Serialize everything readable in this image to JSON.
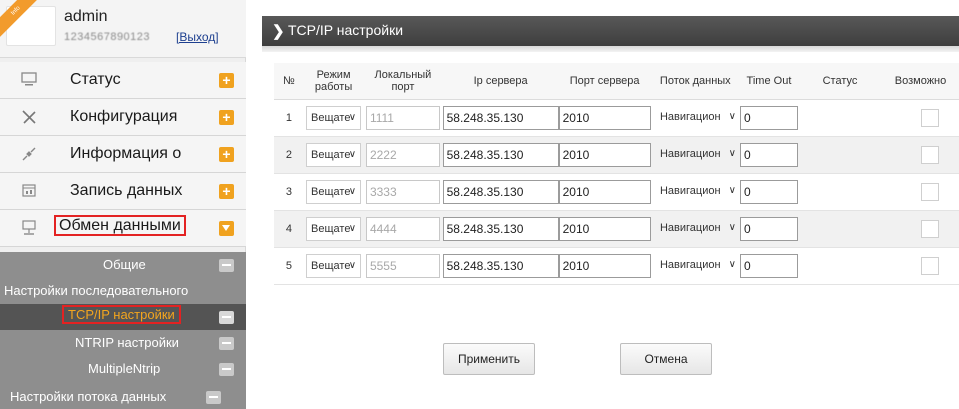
{
  "user": {
    "badge": "Info",
    "name": "admin",
    "serial": "1234567890123",
    "logout": "[Выход]"
  },
  "menu": [
    {
      "label": "Статус",
      "icon": "monitor-icon"
    },
    {
      "label": "Конфигурация",
      "icon": "tools-icon"
    },
    {
      "label": "Информация о",
      "icon": "satellite-icon"
    },
    {
      "label": "Запись данных",
      "icon": "calendar-icon"
    },
    {
      "label": "Обмен данными",
      "icon": "network-icon"
    }
  ],
  "submenu": [
    {
      "label": "Общие"
    },
    {
      "label": "Настройки последовательного"
    },
    {
      "label": "TCP/IP настройки"
    },
    {
      "label": "NTRIP настройки"
    },
    {
      "label": "MultipleNtrip"
    },
    {
      "label": "Настройки потока данных"
    }
  ],
  "page": {
    "title": "TCP/IP настройки"
  },
  "table": {
    "headers": {
      "no": "№",
      "mode": "Режим работы",
      "local_port": "Локальный порт",
      "server_ip": "Ip сервера",
      "server_port": "Порт сервера",
      "stream": "Поток данных",
      "timeout": "Time Out",
      "status": "Статус",
      "enable": "Возможно"
    },
    "rows": [
      {
        "no": "1",
        "mode": "Вещате",
        "local_port": "1111",
        "server_ip": "58.248.35.130",
        "server_port": "2010",
        "stream": "Навигацион",
        "timeout": "0",
        "status": ""
      },
      {
        "no": "2",
        "mode": "Вещате",
        "local_port": "2222",
        "server_ip": "58.248.35.130",
        "server_port": "2010",
        "stream": "Навигацион",
        "timeout": "0",
        "status": ""
      },
      {
        "no": "3",
        "mode": "Вещате",
        "local_port": "3333",
        "server_ip": "58.248.35.130",
        "server_port": "2010",
        "stream": "Навигацион",
        "timeout": "0",
        "status": ""
      },
      {
        "no": "4",
        "mode": "Вещате",
        "local_port": "4444",
        "server_ip": "58.248.35.130",
        "server_port": "2010",
        "stream": "Навигацион",
        "timeout": "0",
        "status": ""
      },
      {
        "no": "5",
        "mode": "Вещате",
        "local_port": "5555",
        "server_ip": "58.248.35.130",
        "server_port": "2010",
        "stream": "Навигацион",
        "timeout": "0",
        "status": ""
      }
    ]
  },
  "buttons": {
    "apply": "Применить",
    "cancel": "Отмена"
  },
  "colors": {
    "accent": "#f0a21f",
    "highlight_border": "#e32222",
    "titlebar": "#4a4a4a"
  }
}
